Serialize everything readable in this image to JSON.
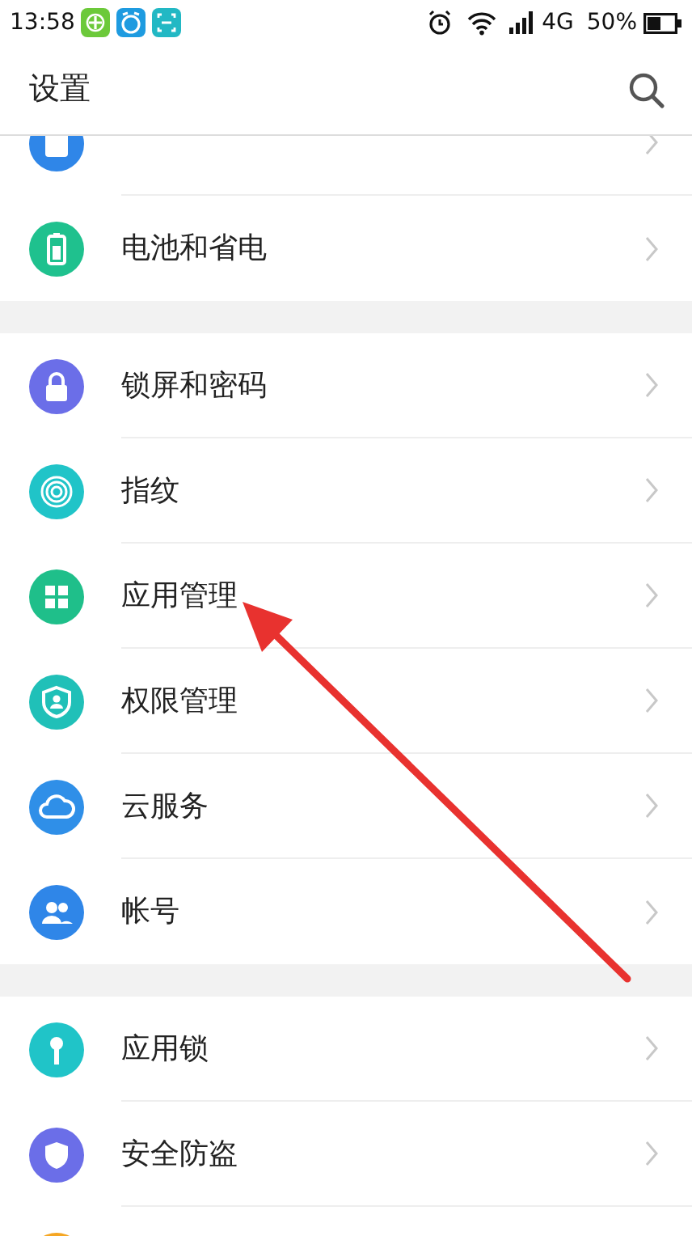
{
  "status_bar": {
    "time": "13:58",
    "notifications": [
      {
        "color": "#6cc93a"
      },
      {
        "color": "#1e9be0"
      },
      {
        "color": "#22b8c4"
      }
    ],
    "network": "4G",
    "battery": "50%"
  },
  "header": {
    "title": "设置"
  },
  "sections": [
    {
      "items": [
        {
          "color": "#2f86e8"
        },
        {
          "label": "电池和省电",
          "color": "#1fc18e"
        }
      ]
    },
    {
      "items": [
        {
          "label": "锁屏和密码",
          "color": "#6b6ee8"
        },
        {
          "label": "指纹",
          "color": "#20c4c8"
        },
        {
          "label": "应用管理",
          "color": "#1fbf8a"
        },
        {
          "label": "权限管理",
          "color": "#20c0b8"
        },
        {
          "label": "云服务",
          "color": "#2f8fe8"
        },
        {
          "label": "帐号",
          "color": "#2f86e8"
        }
      ]
    },
    {
      "items": [
        {
          "label": "应用锁",
          "color": "#20c4c8"
        },
        {
          "label": "安全防盗",
          "color": "#6b6ee8"
        },
        {
          "color": "#f5a623"
        }
      ]
    }
  ],
  "annotation": {
    "kind": "arrow"
  }
}
